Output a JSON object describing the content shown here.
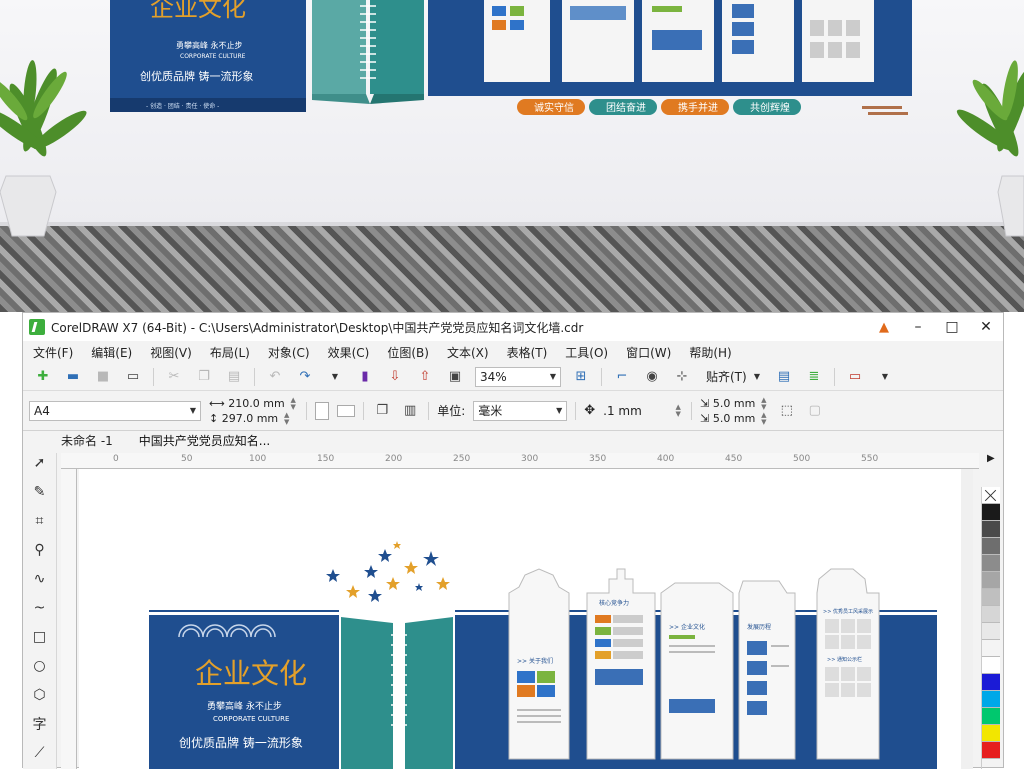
{
  "window": {
    "title": "CorelDRAW X7 (64-Bit) - C:\\Users\\Administrator\\Desktop\\中国共产党党员应知名词文化墙.cdr"
  },
  "menu": [
    "文件(F)",
    "编辑(E)",
    "视图(V)",
    "布局(L)",
    "对象(C)",
    "效果(C)",
    "位图(B)",
    "文本(X)",
    "表格(T)",
    "工具(O)",
    "窗口(W)",
    "帮助(H)"
  ],
  "toolbar": {
    "zoom": "34%",
    "snap": "贴齐(T)"
  },
  "propbar": {
    "page_size": "A4",
    "width": "210.0 mm",
    "height": "297.0 mm",
    "unit_label": "单位:",
    "unit": "毫米",
    "nudge": ".1 mm",
    "dup_x": "5.0 mm",
    "dup_y": "5.0 mm"
  },
  "doc_tabs": [
    "未命名 -1",
    "中国共产党党员应知名..."
  ],
  "ruler_ticks": [
    "0",
    "50",
    "100",
    "150",
    "200",
    "250",
    "300",
    "350",
    "400",
    "450",
    "500",
    "550"
  ],
  "mockup": {
    "board_title": "企业文化",
    "board_slogan_1": "勇攀高峰 永不止步",
    "board_slogan_2": "CORPORATE CULTURE",
    "board_slogan_3": "创优质品牌 铸一流形象",
    "board_strip": "- 创造 · 团结 · 责任 · 使命 -",
    "pills": [
      "诚实守信",
      "团结奋进",
      "携手并进",
      "共创辉煌"
    ]
  },
  "design": {
    "title": "企业文化",
    "slogan_1": "勇攀高峰 永不止步",
    "slogan_2": "CORPORATE CULTURE",
    "slogan_3": "创优质品牌 铸一流形象",
    "section_1": ">> 关于我们",
    "section_2": "核心竞争力",
    "section_3": ">> 企业文化",
    "section_4": "发展历程",
    "section_5": ">> 优秀员工风采展示",
    "section_6": ">> 通知公示栏"
  },
  "colors": {
    "blue": "#1f4e8f",
    "teal": "#2e8f8c",
    "orange": "#e07a21",
    "gold": "#e3a02a"
  }
}
